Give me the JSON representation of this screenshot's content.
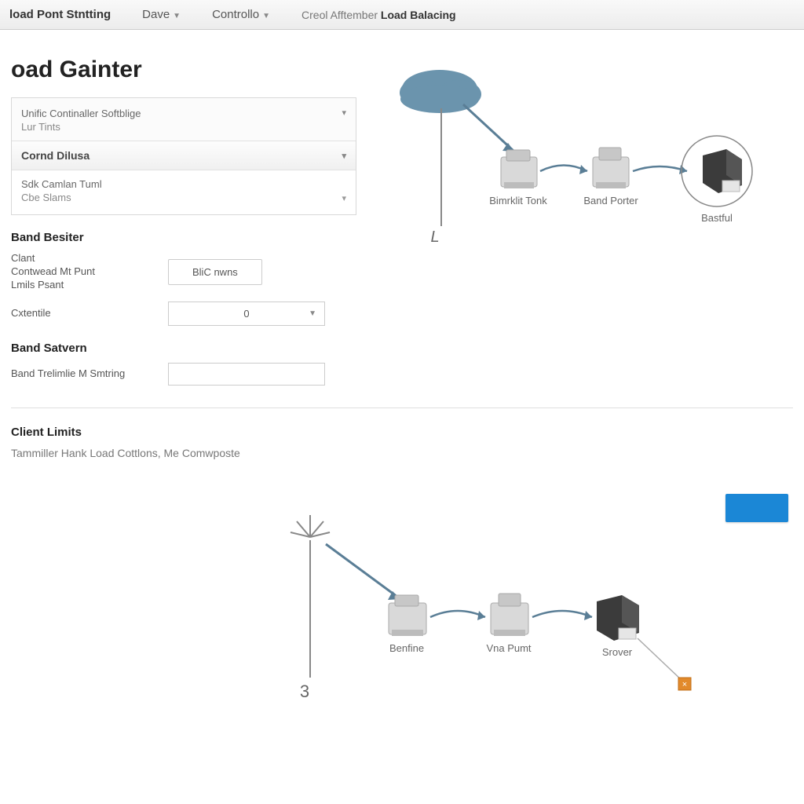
{
  "topbar": {
    "item1": "load Pont Stntting",
    "item2": "Dave",
    "item3": "Controllo",
    "crumb_prefix": "Creol Afftember ",
    "crumb_bold": "Load Balacing"
  },
  "page_title": "oad Gainter",
  "accordion": {
    "group1_line1": "Unific Continaller Softblige",
    "group1_line2": "Lur Tints",
    "group2_head": "Cornd Dilusa",
    "group2_line1": "Sdk Camlan Tuml",
    "group2_line2": "Cbe Slams"
  },
  "band_besiter": {
    "heading": "Band Besiter",
    "label1a": "Clant",
    "label1b": "Contwead Mt Punt",
    "label1c": "Lmils Psant",
    "button1": "BliC nwns",
    "label2": "Cxtentile",
    "select_value": "0"
  },
  "band_savern": {
    "heading": "Band Satvern",
    "label1": "Band Trelimlie M Smtring"
  },
  "client_limits": {
    "heading": "Client Limits",
    "desc": "Tammiller Hank Load Cottlons, Me Comwposte"
  },
  "diagram1": {
    "antenna_label": "L",
    "node1": "Bimrklit Tonk",
    "node2": "Band Porter",
    "node3": "Bastful"
  },
  "diagram2": {
    "antenna_label": "3",
    "node1": "Benfine",
    "node2": "Vna Pumt",
    "node3": "Srover"
  }
}
